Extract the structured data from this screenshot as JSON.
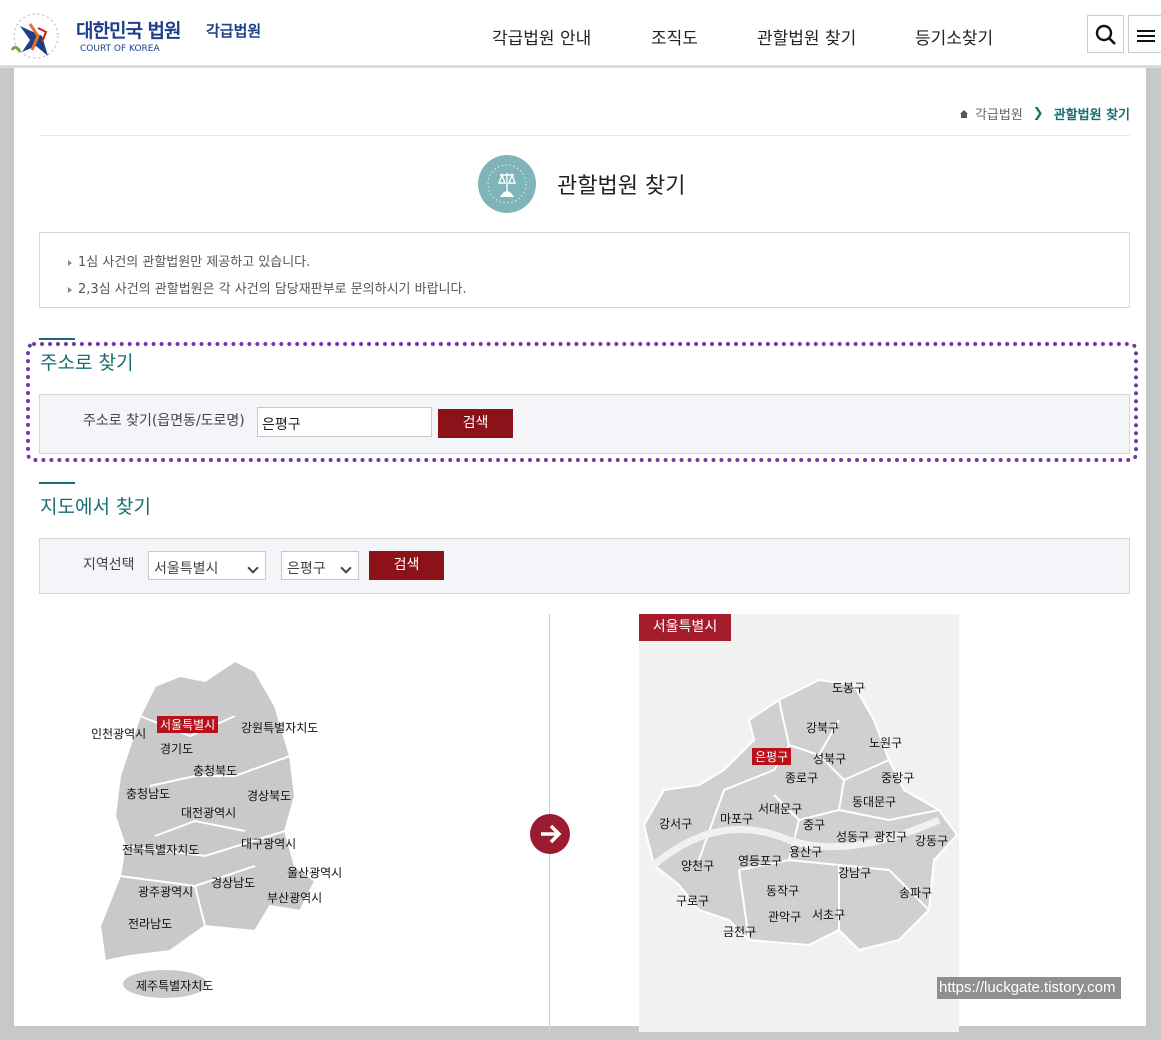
{
  "header": {
    "logo_title": "대한민국 법원",
    "logo_sub": "각급법원",
    "logo_en": "COURT OF KOREA",
    "nav": [
      "각급법원 안내",
      "조직도",
      "관할법원 찾기",
      "등기소찾기"
    ]
  },
  "breadcrumb": {
    "parent": "각급법원",
    "current": "관할법원 찾기"
  },
  "page_title": "관할법원 찾기",
  "notice": [
    "1심 사건의 관할법원만 제공하고 있습니다.",
    "2,3심 사건의 관할법원은 각 사건의 담당재판부로 문의하시기 바랍니다."
  ],
  "address_search": {
    "title": "주소로 찾기",
    "label": "주소로 찾기(읍면동/도로명)",
    "value": "은평구",
    "button": "검색"
  },
  "map_search": {
    "title": "지도에서 찾기",
    "label": "지역선택",
    "region_select": "서울특별시",
    "district_select": "은평구",
    "button": "검색"
  },
  "korea_map": {
    "regions": [
      "서울특별시",
      "인천광역시",
      "경기도",
      "강원특별자치도",
      "충청북도",
      "충청남도",
      "경상북도",
      "대전광역시",
      "대구광역시",
      "전북특별자치도",
      "울산광역시",
      "경상남도",
      "광주광역시",
      "부산광역시",
      "전라남도",
      "제주특별자치도"
    ],
    "selected": "서울특별시"
  },
  "seoul_map": {
    "tag": "서울특별시",
    "districts": [
      "도봉구",
      "강북구",
      "노원구",
      "은평구",
      "성북구",
      "종로구",
      "중랑구",
      "서대문구",
      "동대문구",
      "마포구",
      "강서구",
      "중구",
      "성동구",
      "광진구",
      "강동구",
      "용산구",
      "양천구",
      "영등포구",
      "강남구",
      "동작구",
      "송파구",
      "구로구",
      "관악구",
      "서초구",
      "금천구"
    ],
    "selected": "은평구"
  },
  "watermark": "https://luckgate.tistory.com"
}
